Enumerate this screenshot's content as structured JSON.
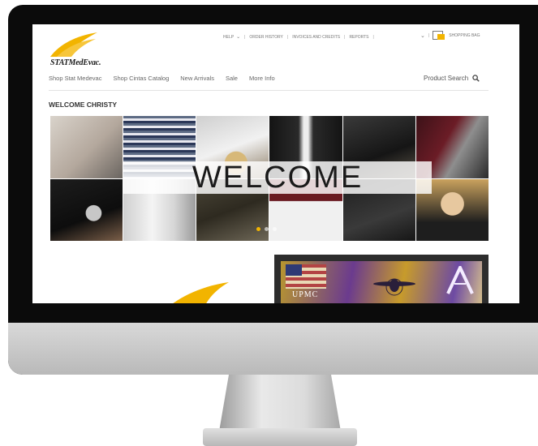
{
  "brand": {
    "logo_text": "STATMedEvac.",
    "accent_color": "#f2b400"
  },
  "utility_nav": {
    "items": [
      "HELP",
      "ORDER HISTORY",
      "INVOICES AND CREDITS",
      "REPORTS"
    ],
    "cart_label": "SHOPPING BAG",
    "cart_count": "0"
  },
  "main_nav": {
    "items": [
      "Shop Stat Medevac",
      "Shop Cintas Catalog",
      "New Arrivals",
      "Sale",
      "More Info"
    ],
    "search_label": "Product Search"
  },
  "page": {
    "heading": "WELCOME CHRISTY"
  },
  "hero": {
    "banner_text": "WELCOME",
    "slide_count": 3,
    "active_slide": 1
  },
  "promo": {
    "text": "UPMC"
  },
  "icons": [
    "logo-swoosh-icon",
    "chevron-down-icon",
    "shopping-bag-icon",
    "search-icon",
    "plane-icon",
    "a-logo-icon"
  ]
}
